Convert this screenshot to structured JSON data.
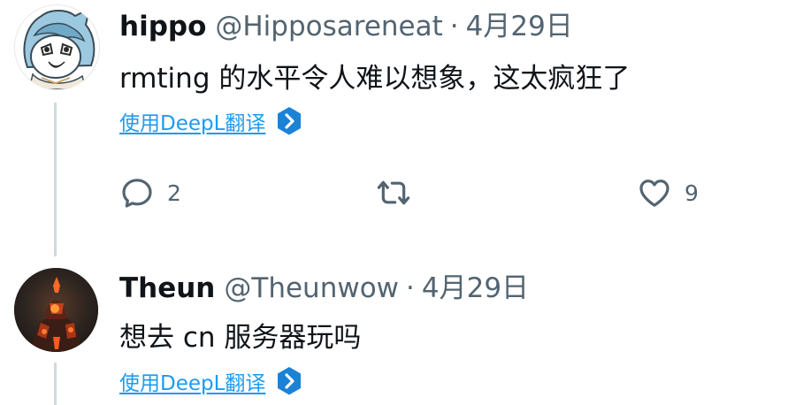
{
  "tweets": [
    {
      "display_name": "hippo",
      "handle": "@Hipposareneat",
      "separator": "·",
      "date": "4月29日",
      "text": "rmting 的水平令人难以想象，这太疯狂了",
      "translate_label": "使用DeepL翻译",
      "avatar_icon": "anime-character-avatar",
      "reply_count": "2",
      "retweet_count": "",
      "like_count": "9"
    },
    {
      "display_name": "Theun",
      "handle": "@Theunwow",
      "separator": "·",
      "date": "4月29日",
      "text": "想去 cn 服务器玩吗",
      "translate_label": "使用DeepL翻译",
      "avatar_icon": "dark-fire-figure-avatar"
    }
  ],
  "icons": {
    "reply": "reply-icon",
    "retweet": "retweet-icon",
    "like": "like-icon",
    "translate": "deepl-icon"
  },
  "colors": {
    "text_primary": "#0f1419",
    "text_secondary": "#536471",
    "link": "#1d9bf0",
    "thread_line": "#cfd9de"
  }
}
